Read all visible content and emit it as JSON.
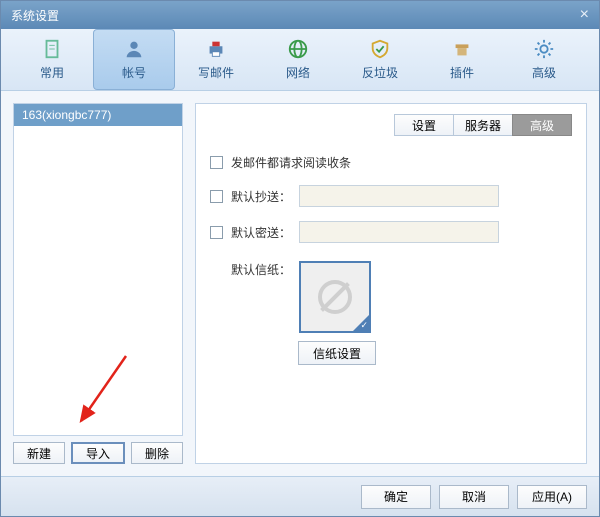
{
  "window": {
    "title": "系统设置"
  },
  "toolbar": {
    "items": [
      {
        "label": "常用"
      },
      {
        "label": "帐号"
      },
      {
        "label": "写邮件"
      },
      {
        "label": "网络"
      },
      {
        "label": "反垃圾"
      },
      {
        "label": "插件"
      },
      {
        "label": "高级"
      }
    ]
  },
  "left": {
    "accounts": [
      "163(xiongbc777)"
    ],
    "buttons": {
      "new": "新建",
      "import": "导入",
      "delete": "删除"
    }
  },
  "tabs": {
    "t1": "设置",
    "t2": "服务器",
    "t3": "高级"
  },
  "form": {
    "read_receipt": "发邮件都请求阅读收条",
    "cc_label": "默认抄送：",
    "bcc_label": "默认密送：",
    "stationery_label": "默认信纸：",
    "stationery_btn": "信纸设置"
  },
  "footer": {
    "ok": "确定",
    "cancel": "取消",
    "apply": "应用(A)"
  }
}
